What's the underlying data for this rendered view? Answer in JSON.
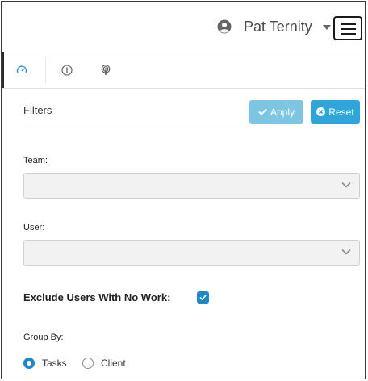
{
  "header": {
    "user_icon": "user-circle-icon",
    "user_name": "Pat Ternity",
    "dropdown_icon": "caret-down-icon",
    "menu_icon": "hamburger-menu-icon"
  },
  "tabs": [
    {
      "icon": "gauge-icon",
      "active": true
    },
    {
      "icon": "info-icon",
      "active": false
    },
    {
      "icon": "podcast-icon",
      "active": false
    }
  ],
  "filters": {
    "title": "Filters",
    "apply_label": "Apply",
    "reset_label": "Reset",
    "team_label": "Team:",
    "team_value": "",
    "user_label": "User:",
    "user_value": "",
    "exclude_label": "Exclude Users With No Work:",
    "exclude_checked": true,
    "group_by_label": "Group By:",
    "group_by_options": [
      "Tasks",
      "Client"
    ],
    "group_by_selected": "Tasks"
  },
  "colors": {
    "apply_button": "#7cc6e4",
    "reset_button": "#2ea6da",
    "accent": "#1e88c8"
  }
}
